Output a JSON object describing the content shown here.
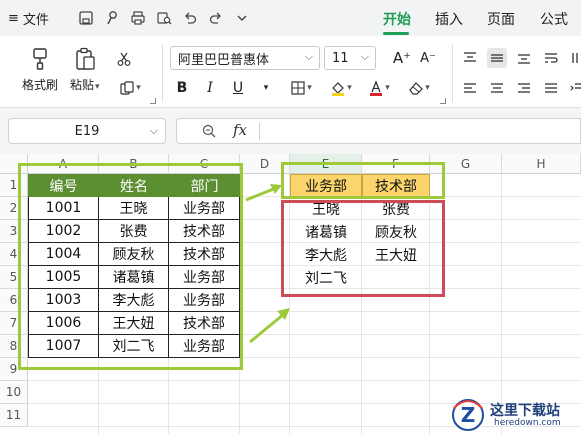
{
  "menu": {
    "hamburger": "≡",
    "file_label": "文件",
    "tabs": [
      {
        "label": "开始",
        "active": true
      },
      {
        "label": "插入",
        "active": false
      },
      {
        "label": "页面",
        "active": false
      },
      {
        "label": "公式",
        "active": false
      }
    ],
    "quick_icons": [
      "save-icon",
      "format-painter-quick-icon",
      "print-icon",
      "print-preview-icon",
      "undo-icon",
      "redo-icon",
      "more-chevron-icon"
    ]
  },
  "ribbon": {
    "format_painter": "格式刷",
    "paste": "粘贴",
    "paste_arrow": "▾",
    "font_name": "阿里巴巴普惠体",
    "font_size": "11",
    "bold": "B",
    "italic": "I",
    "underline": "U",
    "increase_font": "A⁺",
    "decrease_font": "A⁻",
    "accent_color": "#1f9d55",
    "highlight_color": "#f2d21b",
    "font_color": "#d9262c"
  },
  "formula_bar": {
    "cell_ref": "E19",
    "fx": "fx",
    "formula": ""
  },
  "sheet": {
    "columns": [
      "A",
      "B",
      "C",
      "D",
      "E",
      "F",
      "G",
      "H"
    ],
    "rows": [
      "1",
      "2",
      "3",
      "4",
      "5",
      "6",
      "7",
      "8",
      "9",
      "10",
      "11"
    ],
    "source_table": {
      "headers": [
        "编号",
        "姓名",
        "部门"
      ],
      "rows": [
        [
          "1001",
          "王晓",
          "业务部"
        ],
        [
          "1002",
          "张费",
          "技术部"
        ],
        [
          "1004",
          "顾友秋",
          "技术部"
        ],
        [
          "1005",
          "诸葛镇",
          "业务部"
        ],
        [
          "1003",
          "李大彪",
          "业务部"
        ],
        [
          "1006",
          "王大妞",
          "技术部"
        ],
        [
          "1007",
          "刘二飞",
          "业务部"
        ]
      ],
      "header_color": "#5b8f32"
    },
    "result_table": {
      "headers": [
        "业务部",
        "技术部"
      ],
      "columns": [
        [
          "王晓",
          "诸葛镇",
          "李大彪",
          "刘二飞"
        ],
        [
          "张费",
          "顾友秋",
          "王大妞"
        ]
      ],
      "header_color": "#fbd56b"
    },
    "frame_colors": {
      "green": "#9dc93a",
      "red": "#cf4b57"
    }
  },
  "watermark": {
    "title": "这里下载站",
    "url": "heredown.com"
  }
}
